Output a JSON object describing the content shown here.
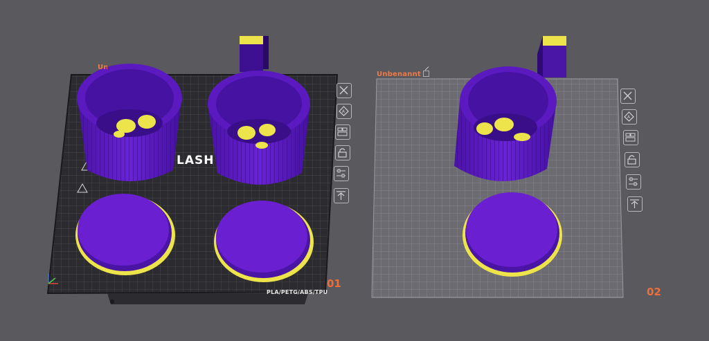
{
  "plates": [
    {
      "name": "Unbenannt",
      "number": "01",
      "filament_label": "PLA/PETG/ABS/TPU",
      "brand_text": "LASH"
    },
    {
      "name": "Unbenannt",
      "number": "02"
    }
  ],
  "toolbar_icons": [
    "close-icon",
    "auto-orient-icon",
    "arrange-icon",
    "lock-icon",
    "plate-settings-icon",
    "move-to-top-icon"
  ],
  "colors": {
    "background": "#59595e",
    "part_purple": "#6a1fd0",
    "part_yellow": "#ece44a",
    "accent": "#f07a46"
  }
}
